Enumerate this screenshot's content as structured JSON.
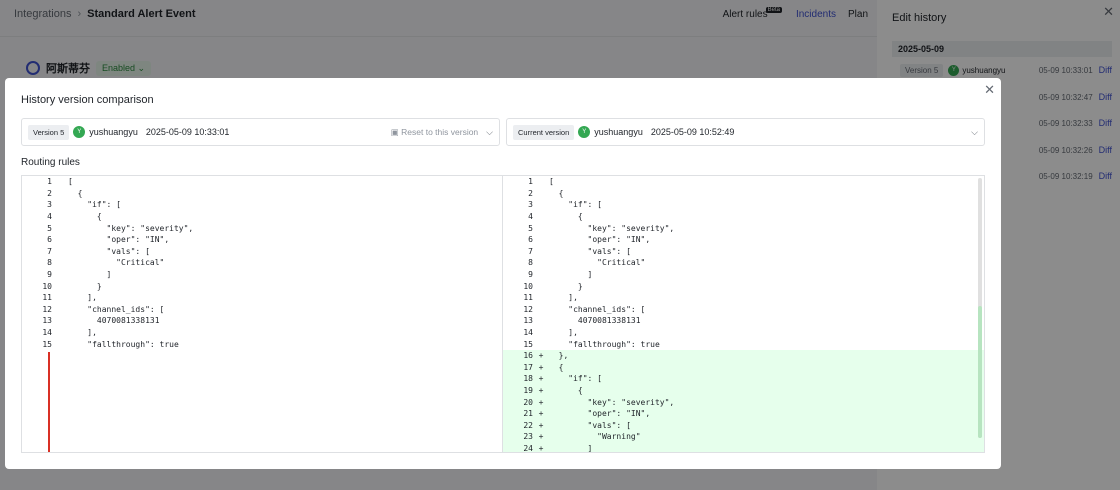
{
  "bg": {
    "breadcrumb_root": "Integrations",
    "breadcrumb_current": "Standard Alert Event",
    "nav": {
      "alert_rules": "Alert rules",
      "beta": "Beta",
      "incidents": "Incidents",
      "plan": "Plan"
    },
    "entity_name": "阿斯蒂芬",
    "status": "Enabled"
  },
  "drawer": {
    "title": "Edit history",
    "date": "2025-05-09",
    "items": [
      {
        "tag": "Version 5",
        "avatar": "Y",
        "user": "yushuangyu",
        "time": "05-09 10:33:01",
        "diff": "Diff"
      },
      {
        "tag": "",
        "avatar": "",
        "user": "",
        "time": "05-09 10:32:47",
        "diff": "Diff"
      },
      {
        "tag": "",
        "avatar": "",
        "user": "",
        "time": "05-09 10:32:33",
        "diff": "Diff"
      },
      {
        "tag": "",
        "avatar": "",
        "user": "",
        "time": "05-09 10:32:26",
        "diff": "Diff"
      },
      {
        "tag": "",
        "avatar": "",
        "user": "",
        "time": "05-09 10:32:19",
        "diff": "Diff"
      }
    ]
  },
  "modal": {
    "title": "History version comparison",
    "left": {
      "tag": "Version 5",
      "avatar": "Y",
      "user": "yushuangyu",
      "time": "2025-05-09 10:33:01",
      "reset": "Reset to this version"
    },
    "right": {
      "tag": "Current version",
      "avatar": "Y",
      "user": "yushuangyu",
      "time": "2025-05-09 10:52:49"
    },
    "section": "Routing rules",
    "left_lines": [
      {
        "n": "1",
        "code": "["
      },
      {
        "n": "2",
        "code": "  {"
      },
      {
        "n": "3",
        "code": "    \"if\": ["
      },
      {
        "n": "4",
        "code": "      {"
      },
      {
        "n": "5",
        "code": "        \"key\": \"severity\","
      },
      {
        "n": "6",
        "code": "        \"oper\": \"IN\","
      },
      {
        "n": "7",
        "code": "        \"vals\": ["
      },
      {
        "n": "8",
        "code": "          \"Critical\""
      },
      {
        "n": "9",
        "code": "        ]"
      },
      {
        "n": "10",
        "code": "      }"
      },
      {
        "n": "11",
        "code": "    ],"
      },
      {
        "n": "12",
        "code": "    \"channel_ids\": ["
      },
      {
        "n": "13",
        "code": "      4070081338131"
      },
      {
        "n": "14",
        "code": "    ],"
      },
      {
        "n": "15",
        "code": "    \"fallthrough\": true"
      }
    ],
    "right_lines": [
      {
        "n": "1",
        "m": "",
        "code": "["
      },
      {
        "n": "2",
        "m": "",
        "code": "  {"
      },
      {
        "n": "3",
        "m": "",
        "code": "    \"if\": ["
      },
      {
        "n": "4",
        "m": "",
        "code": "      {"
      },
      {
        "n": "5",
        "m": "",
        "code": "        \"key\": \"severity\","
      },
      {
        "n": "6",
        "m": "",
        "code": "        \"oper\": \"IN\","
      },
      {
        "n": "7",
        "m": "",
        "code": "        \"vals\": ["
      },
      {
        "n": "8",
        "m": "",
        "code": "          \"Critical\""
      },
      {
        "n": "9",
        "m": "",
        "code": "        ]"
      },
      {
        "n": "10",
        "m": "",
        "code": "      }"
      },
      {
        "n": "11",
        "m": "",
        "code": "    ],"
      },
      {
        "n": "12",
        "m": "",
        "code": "    \"channel_ids\": ["
      },
      {
        "n": "13",
        "m": "",
        "code": "      4070081338131"
      },
      {
        "n": "14",
        "m": "",
        "code": "    ],"
      },
      {
        "n": "15",
        "m": "",
        "code": "    \"fallthrough\": true"
      },
      {
        "n": "16",
        "m": "+",
        "code": "  },"
      },
      {
        "n": "17",
        "m": "+",
        "code": "  {"
      },
      {
        "n": "18",
        "m": "+",
        "code": "    \"if\": ["
      },
      {
        "n": "19",
        "m": "+",
        "code": "      {"
      },
      {
        "n": "20",
        "m": "+",
        "code": "        \"key\": \"severity\","
      },
      {
        "n": "21",
        "m": "+",
        "code": "        \"oper\": \"IN\","
      },
      {
        "n": "22",
        "m": "+",
        "code": "        \"vals\": ["
      },
      {
        "n": "23",
        "m": "+",
        "code": "          \"Warning\""
      },
      {
        "n": "24",
        "m": "+",
        "code": "        ]"
      }
    ]
  }
}
